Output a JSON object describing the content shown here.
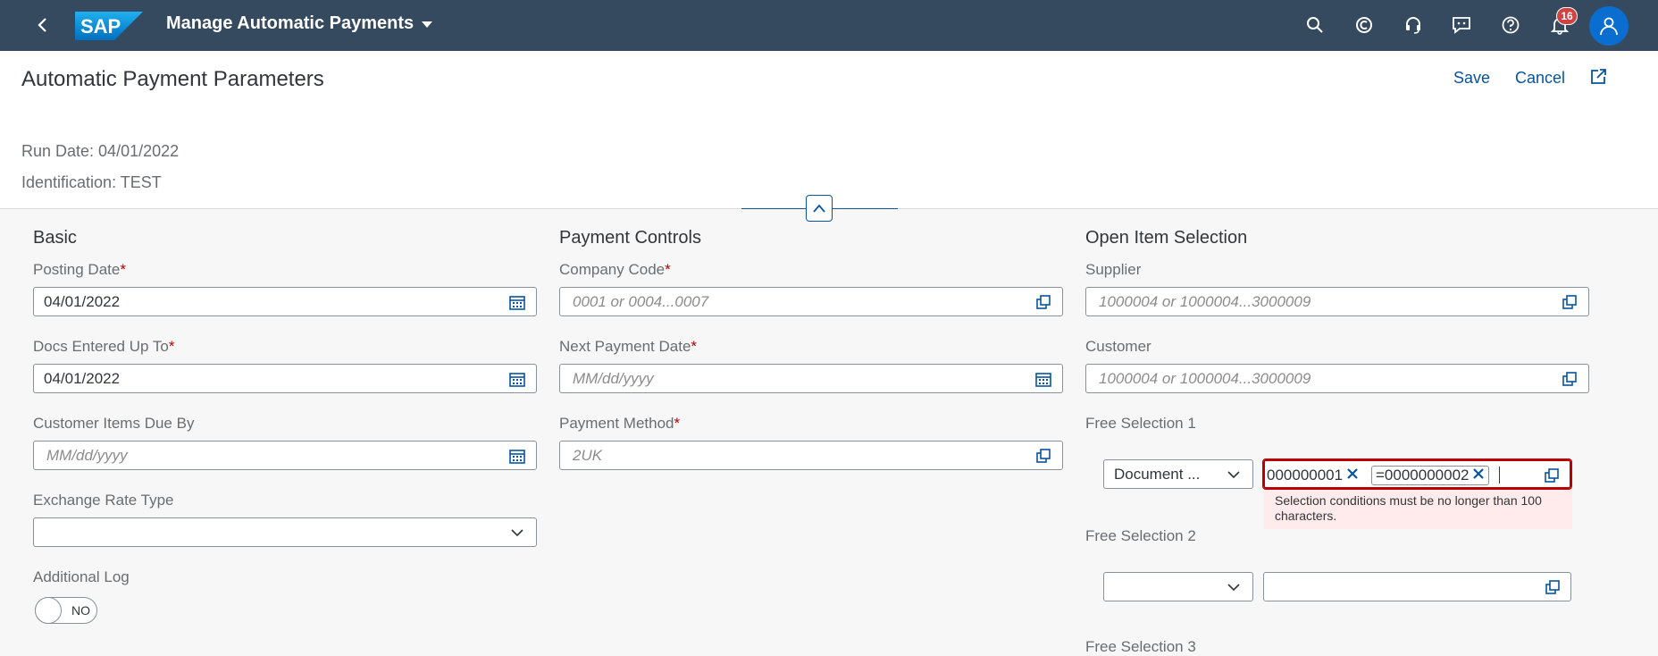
{
  "shell": {
    "logo_text": "SAP",
    "app_title": "Manage Automatic Payments",
    "notification_count": "16"
  },
  "header": {
    "title": "Automatic Payment Parameters",
    "save_label": "Save",
    "cancel_label": "Cancel",
    "run_date": "Run Date: 04/01/2022",
    "identification": "Identification: TEST"
  },
  "basic": {
    "title": "Basic",
    "posting_date_label": "Posting Date",
    "posting_date_value": "04/01/2022",
    "docs_entered_label": "Docs Entered Up To",
    "docs_entered_value": "04/01/2022",
    "customer_items_label": "Customer Items Due By",
    "customer_items_placeholder": "MM/dd/yyyy",
    "exchange_rate_label": "Exchange Rate Type",
    "exchange_rate_value": "",
    "additional_log_label": "Additional Log",
    "additional_log_state": "NO"
  },
  "payment_controls": {
    "title": "Payment Controls",
    "company_code_label": "Company Code",
    "company_code_placeholder": "0001 or 0004...0007",
    "next_payment_label": "Next Payment Date",
    "next_payment_placeholder": "MM/dd/yyyy",
    "payment_method_label": "Payment Method",
    "payment_method_placeholder": "2UK"
  },
  "open_item": {
    "title": "Open Item Selection",
    "supplier_label": "Supplier",
    "supplier_placeholder": "1000004 or 1000004...3000009",
    "customer_label": "Customer",
    "customer_placeholder": "1000004 or 1000004...3000009",
    "free_sel_1_label": "Free Selection 1",
    "free_sel_1_field": "Document ...",
    "free_sel_1_token_1": "000000001",
    "free_sel_1_token_2": "=0000000002",
    "free_sel_1_error": "Selection conditions must be no longer than 100 characters.",
    "free_sel_2_label": "Free Selection 2",
    "free_sel_2_field": "",
    "free_sel_3_label": "Free Selection 3"
  },
  "colors": {
    "shell_bg": "#354a5f",
    "link": "#0854a0",
    "required": "#bb0000",
    "error_bg": "#ffebeb"
  }
}
